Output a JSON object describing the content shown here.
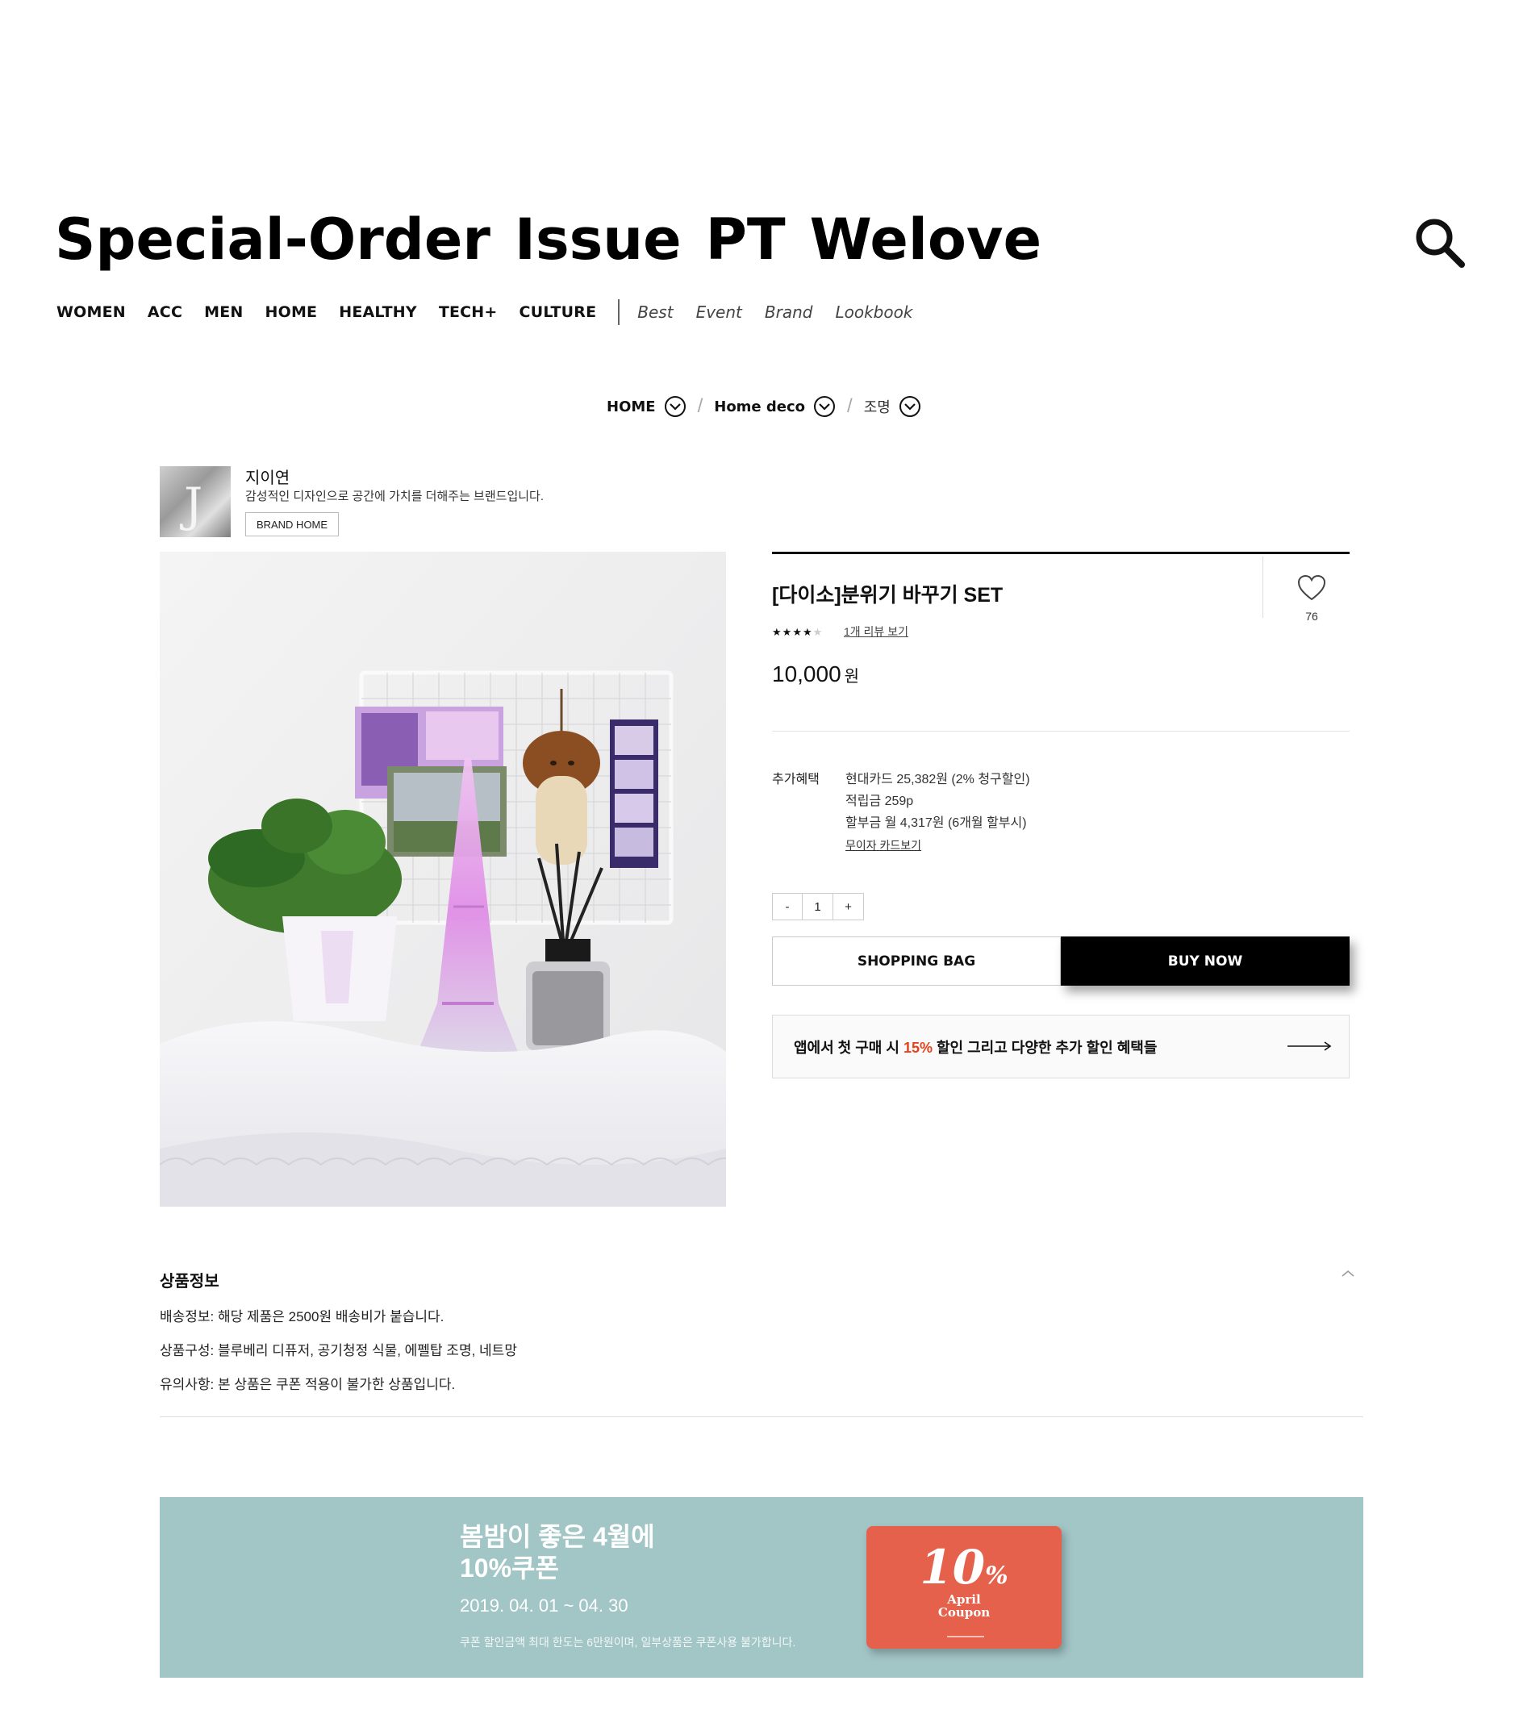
{
  "header": {
    "logo_words": [
      "Special-Order",
      "Issue",
      "PT",
      "Welove"
    ],
    "categories": [
      "WOMEN",
      "ACC",
      "MEN",
      "HOME",
      "HEALTHY",
      "TECH+",
      "CULTURE"
    ],
    "sub_links": [
      "Best",
      "Event",
      "Brand",
      "Lookbook"
    ],
    "search_icon": "search-icon"
  },
  "breadcrumb": [
    "HOME",
    "Home deco",
    "조명"
  ],
  "brand": {
    "initial": "J",
    "name": "지이연",
    "description": "감성적인  디자인으로 공간에 가치를 더해주는 브랜드입니다.",
    "home_button": "BRAND HOME"
  },
  "product": {
    "title": "[다이소]분위기 바꾸기 SET",
    "like_count": "76",
    "rating": 4,
    "rating_max": 5,
    "review_link": "1개 리뷰 보기",
    "price": "10,000",
    "currency": "원",
    "benefits_label": "추가혜택",
    "benefits": [
      "현대카드 25,382원 (2% 청구할인)",
      "적립금 259p",
      "할부금 월 4,317원 (6개월 할부시)"
    ],
    "card_link": "무이자 카드보기",
    "quantity": {
      "minus": "-",
      "value": "1",
      "plus": "+"
    },
    "shopping_bag": "SHOPPING BAG",
    "buy_now": "BUY NOW",
    "app_banner": {
      "before": "앱에서 첫 구매 시 ",
      "highlight": "15%",
      "after": " 할인 그리고 다양한 추가 할인 혜택들"
    }
  },
  "detail": {
    "title": "상품정보",
    "lines": [
      "배송정보: 해당 제품은 2500원 배송비가 붙습니다.",
      "상품구성: 블루베리 디퓨저, 공기청정 식물, 에펠탑 조명, 네트망",
      "유의사항: 본 상품은 쿠폰 적용이 불가한 상품입니다."
    ]
  },
  "coupon_banner": {
    "headline_1": "봄밤이 좋은 4월에",
    "headline_2": "10%쿠폰",
    "dates": "2019. 04. 01 ~ 04. 30",
    "note": "쿠폰 할인금액 최대 한도는 6만원이며, 일부상품은 쿠폰사용 불가합니다.",
    "card_percent": "10",
    "card_percent_sign": "%",
    "card_line_1": "April",
    "card_line_2": "Coupon"
  },
  "colors": {
    "accent_highlight": "#e8411e",
    "banner_bg": "#a2c5c6",
    "coupon_card": "#e5614c",
    "buy_button": "#000000"
  }
}
